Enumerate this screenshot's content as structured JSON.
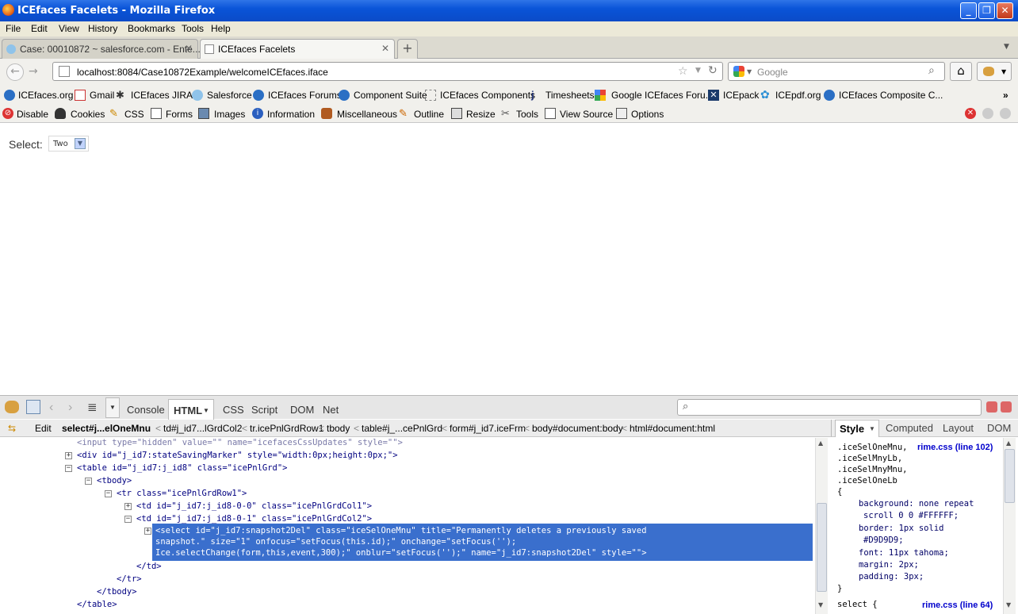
{
  "window": {
    "title": "ICEfaces Facelets - Mozilla Firefox"
  },
  "menu": [
    "File",
    "Edit",
    "View",
    "History",
    "Bookmarks",
    "Tools",
    "Help"
  ],
  "tabs": [
    {
      "label": "Case: 00010872 ~ salesforce.com - Ente...",
      "active": false
    },
    {
      "label": "ICEfaces Facelets",
      "active": true
    }
  ],
  "nav": {
    "url": "localhost:8084/Case10872Example/welcomeICEfaces.iface",
    "search_placeholder": "Google"
  },
  "bookmarks": [
    "ICEfaces.org",
    "Gmail",
    "ICEfaces JIRA",
    "Salesforce",
    "ICEfaces Forums",
    "Component Suite",
    "ICEfaces Components",
    "Timesheets",
    "Google ICEfaces Foru...",
    "ICEpack",
    "ICEpdf.org",
    "ICEfaces Composite C..."
  ],
  "webdev": [
    "Disable",
    "Cookies",
    "CSS",
    "Forms",
    "Images",
    "Information",
    "Miscellaneous",
    "Outline",
    "Resize",
    "Tools",
    "View Source",
    "Options"
  ],
  "page": {
    "select_label": "Select:",
    "select_value": "Two"
  },
  "firebug": {
    "tabs": [
      "Console",
      "HTML",
      "CSS",
      "Script",
      "DOM",
      "Net"
    ],
    "edit_label": "Edit",
    "breadcrumbs": [
      "select#j...elOneMnu",
      "td#j_id7...lGrdCol2",
      "tr.icePnlGrdRow1",
      "tbody",
      "table#j_...cePnlGrd",
      "form#j_id7.iceFrm",
      "body#document:body",
      "html#document:html"
    ],
    "side_tabs": [
      "Style",
      "Computed",
      "Layout",
      "DOM"
    ],
    "html_lines": [
      "<input type=\"hidden\" value=\"\" name=\"icefacesCssUpdates\" style=\"\">",
      "<div id=\"j_id7:stateSavingMarker\" style=\"width:0px;height:0px;\">",
      "<table id=\"j_id7:j_id8\" class=\"icePnlGrd\">",
      "<tbody>",
      "<tr class=\"icePnlGrdRow1\">",
      "<td id=\"j_id7:j_id8-0-0\" class=\"icePnlGrdCol1\">",
      "<td id=\"j_id7:j_id8-0-1\" class=\"icePnlGrdCol2\">",
      "<select id=\"j_id7:snapshot2Del\" class=\"iceSelOneMnu\" title=\"Permanently deletes a previously saved",
      "snapshot.\" size=\"1\" onfocus=\"setFocus(this.id);\" onchange=\"setFocus('');",
      "Ice.selectChange(form,this,event,300);\" onblur=\"setFocus('');\" name=\"j_id7:snapshot2Del\" style=\"\">",
      "</td>",
      "</tr>",
      "</tbody>",
      "</table>"
    ],
    "css_lines": [
      ".iceSelOneMnu,",
      ".iceSelMnyLb,",
      ".iceSelMnyMnu,",
      ".iceSelOneLb",
      "{",
      "background: none repeat",
      "scroll 0 0 #FFFFFF;",
      "border: 1px solid",
      "#D9D9D9;",
      "font: 11px tahoma;",
      "margin: 2px;",
      "padding: 3px;",
      "}",
      "select {"
    ],
    "css_links": [
      "rime.css (line 102)",
      "rime.css (line 64)"
    ]
  }
}
